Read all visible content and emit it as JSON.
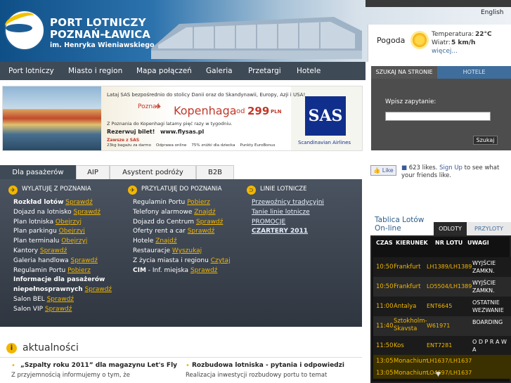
{
  "header": {
    "logo_line1": "PORT LOTNICZY",
    "logo_line2": "POZNAŃ-ŁAWICA",
    "logo_line3": "im. Henryka Wieniawskiego",
    "language": "English"
  },
  "weather": {
    "title": "Pogoda",
    "temp_label": "Temperatura:",
    "temp_value": "22°C",
    "wind_label": "Wiatr:",
    "wind_value": "5 km/h",
    "more": "więcej..."
  },
  "nav": [
    "Port lotniczy",
    "Miasto i region",
    "Mapa połączeń",
    "Galeria",
    "Przetargi",
    "Hotele"
  ],
  "search": {
    "tab1": "SZUKAJ NA STRONIE",
    "tab2": "HOTELE",
    "label": "Wpisz zapytanie:",
    "button": "Szukaj"
  },
  "banner": {
    "line1": "Lataj SAS bezpośrednio do stolicy Danii oraz do Skandynawii, Europy, Azji i USA!",
    "from": "Poznań",
    "to": "Kopenhaga",
    "od": "od",
    "price": "299",
    "currency": "PLN",
    "freq": "Z Poznania do Kopenhagi latamy pięć razy w tygodniu.",
    "book": "Rezerwuj bilet!",
    "url": "www.flysas.pl",
    "always": "Zawsze z SAS",
    "perks": "23kg bagażu za darmo    Odprawa online    75% zniżki dla dziecka    Punkty EuroBonus",
    "logo": "SAS",
    "airline": "Scandinavian Airlines"
  },
  "ctabs": [
    "Dla pasażerów",
    "AIP",
    "Asystent podróży",
    "B2B"
  ],
  "col1": {
    "title": "WYLATUJĘ Z POZNANIA",
    "items": [
      {
        "t": "Rozkład lotów",
        "l": "Sprawdź",
        "b": true
      },
      {
        "t": "Dojazd na lotnisko",
        "l": "Sprawdź"
      },
      {
        "t": "Plan lotniska",
        "l": "Obejrzyj"
      },
      {
        "t": "Plan parkingu",
        "l": "Obejrzyj"
      },
      {
        "t": "Plan terminalu",
        "l": "Obejrzyj"
      },
      {
        "t": "Kantory",
        "l": "Sprawdź"
      },
      {
        "t": "Galeria handlowa",
        "l": "Sprawdź"
      },
      {
        "t": "Regulamin Portu",
        "l": "Pobierz"
      },
      {
        "t": "Informacje dla pasażerów",
        "b": true
      },
      {
        "t": "niepełnosprawnych",
        "l": "Sprawdź",
        "b": true
      },
      {
        "t": "Salon BEL",
        "l": "Sprawdź"
      },
      {
        "t": "Salon VIP",
        "l": "Sprawdź"
      }
    ]
  },
  "col2": {
    "title": "PRZYLATUJĘ DO POZNANIA",
    "items": [
      {
        "t": "Regulamin Portu",
        "l": "Pobierz"
      },
      {
        "t": "Telefony alarmowe",
        "l": "Znajdź"
      },
      {
        "t": "Dojazd do Centrum",
        "l": "Sprawdź"
      },
      {
        "t": "Oferty rent a car",
        "l": "Sprawdź"
      },
      {
        "t": "Hotele",
        "l": "Znajdź"
      },
      {
        "t": "Restauracje",
        "l": "Wyszukaj"
      },
      {
        "t": "Z życia miasta i regionu",
        "l": "Czytaj"
      },
      {
        "t": "CIM",
        "t2": " - Inf. miejska",
        "l": "Sprawdź",
        "b": true
      }
    ]
  },
  "col3": {
    "title": "LINIE LOTNICZE",
    "items": [
      "Przewoźnicy tradycyjni",
      "Tanie linie lotnicze",
      "PROMOCJE",
      "CZARTERY 2011"
    ]
  },
  "news": {
    "title": "aktualności",
    "item1_title": "„Szpalty roku 2011” dla magazynu Let's Fly",
    "item1_body": "Z przyjemnością informujemy o tym, że",
    "item2_title": "Rozbudowa lotniska - pytania i odpowiedzi",
    "item2_body": "Realizacja inwestycji rozbudowy portu to temat"
  },
  "facebook": {
    "like": "Like",
    "count_text": "623 likes.",
    "signup": "Sign Up",
    "rest": "to see what your friends like."
  },
  "flights": {
    "title1": "Tablica Lotów",
    "title2": "On-line",
    "tab_departures": "ODLOTY",
    "tab_arrivals": "PRZYLOTY",
    "headers": [
      "CZAS",
      "KIERUNEK",
      "NR LOTU",
      "UWAGI"
    ],
    "rows": [
      {
        "time": "10:50",
        "dest": "Frankfurt",
        "flight": "LH1389/LH1389",
        "status": "WYJŚCIE ZAMKN."
      },
      {
        "time": "10:50",
        "dest": "Frankfurt",
        "flight": "LO5504/LH1389",
        "status": "WYJŚCIE ZAMKN."
      },
      {
        "time": "11:00",
        "dest": "Antalya",
        "flight": "ENT6645",
        "status": "OSTATNIE WEZWANIE"
      },
      {
        "time": "11:40",
        "dest": "Sztokholm-Skavsta",
        "flight": "W61971",
        "status": "BOARDING"
      },
      {
        "time": "11:50",
        "dest": "Kos",
        "flight": "ENT7281",
        "status": "O D P R A W A"
      },
      {
        "time": "13:05",
        "dest": "Monachium",
        "flight": "LH1637/LH1637",
        "status": ""
      },
      {
        "time": "13:05",
        "dest": "Monachium",
        "flight": "LO4697/LH1637",
        "status": ""
      }
    ]
  }
}
